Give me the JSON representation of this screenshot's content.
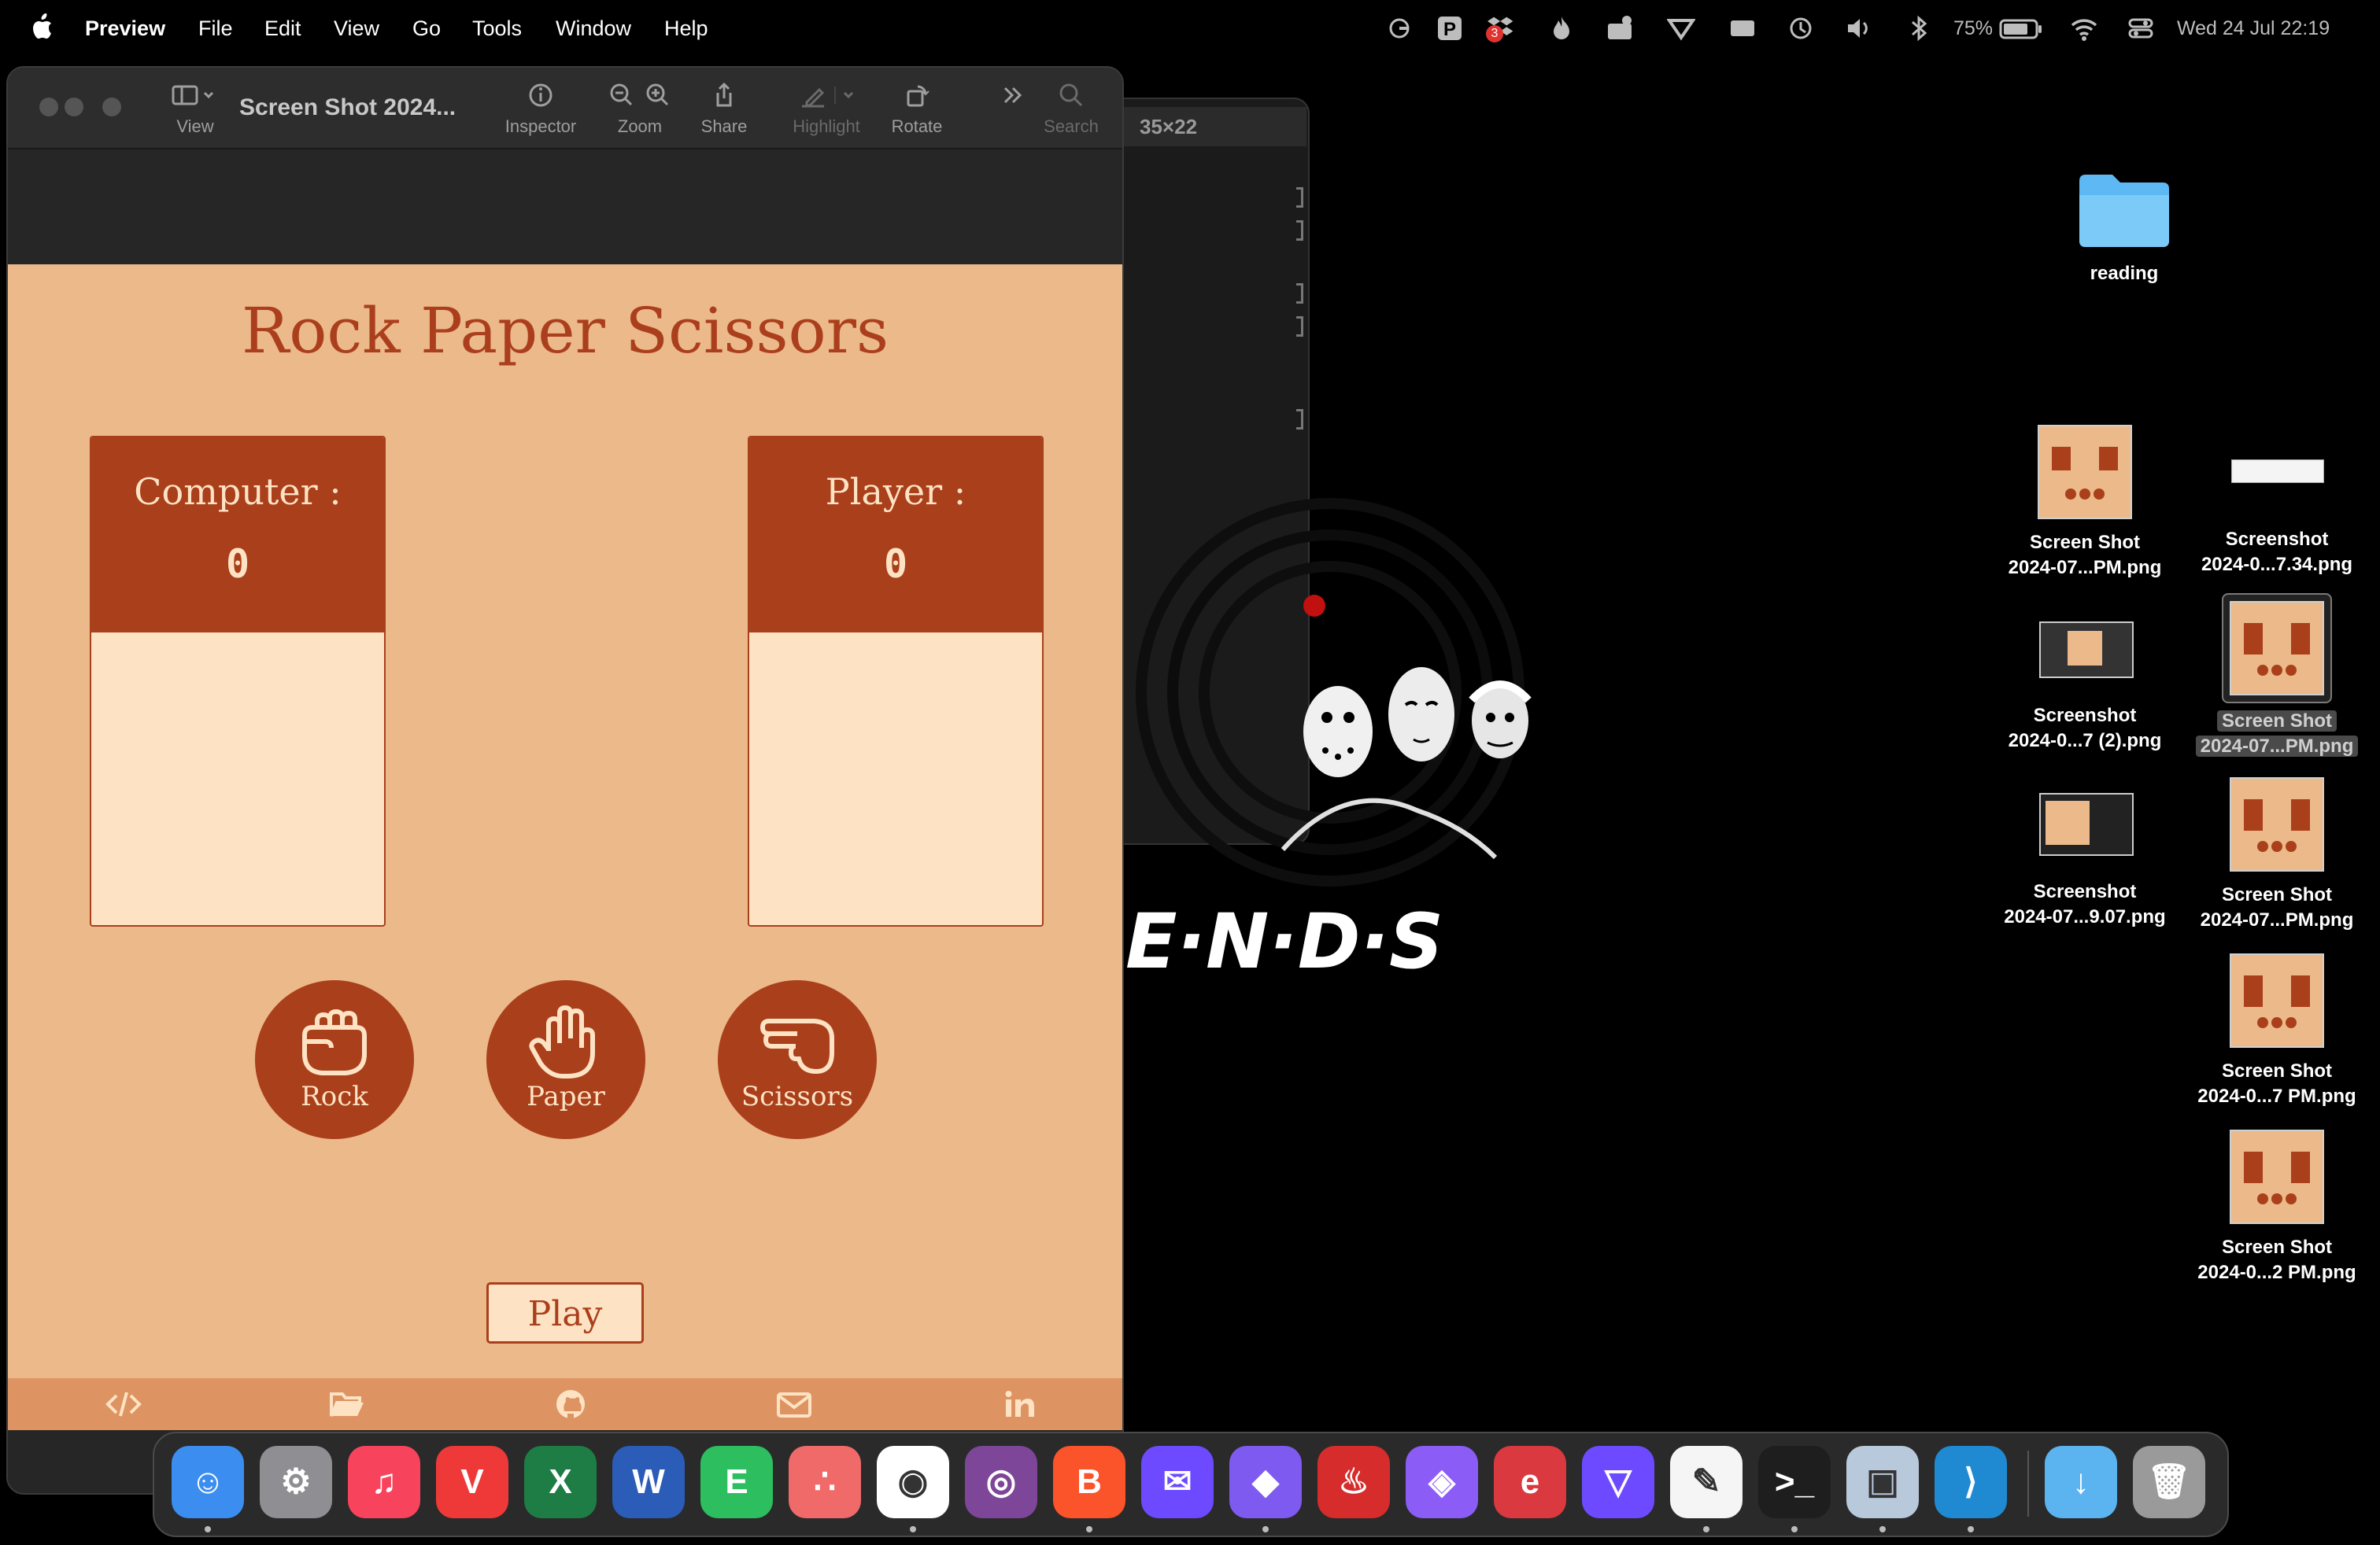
{
  "menubar": {
    "app_name": "Preview",
    "menus": [
      "File",
      "Edit",
      "View",
      "Go",
      "Tools",
      "Window",
      "Help"
    ],
    "battery": "75%",
    "datetime": "Wed 24 Jul  22:19",
    "notification_badge": "3"
  },
  "terminal": {
    "title": "35×22"
  },
  "wallpaper": {
    "text": "E·N·D·S"
  },
  "preview": {
    "doc_title": "Screen Shot 2024...",
    "toolbar": {
      "view": "View",
      "inspector": "Inspector",
      "zoom": "Zoom",
      "share": "Share",
      "highlight": "Highlight",
      "rotate": "Rotate",
      "search": "Search"
    }
  },
  "game": {
    "title": "Rock Paper Scissors",
    "computer_label": "Computer :",
    "computer_score": "0",
    "player_label": "Player :",
    "player_score": "0",
    "choices": [
      {
        "label": "Rock",
        "icon": "rock-hand-icon"
      },
      {
        "label": "Paper",
        "icon": "paper-hand-icon"
      },
      {
        "label": "Scissors",
        "icon": "scissors-hand-icon"
      }
    ],
    "play_label": "Play",
    "footer_icons": [
      "code-icon",
      "folder-icon",
      "github-icon",
      "mail-icon",
      "linkedin-icon"
    ],
    "colors": {
      "background": "#ebb98a",
      "primary": "#aa3f1b",
      "light": "#fde3c4",
      "footer": "#de9462"
    }
  },
  "desktop": {
    "folder": {
      "name": "reading"
    },
    "files": [
      {
        "line1": "Screen Shot",
        "line2": "2024-07...PM.png"
      },
      {
        "line1": "Screenshot",
        "line2": "2024-0...7.34.png"
      },
      {
        "line1": "Screenshot",
        "line2": "2024-0...7 (2).png"
      },
      {
        "line1": "Screen Shot",
        "line2": "2024-07...PM.png"
      },
      {
        "line1": "Screenshot",
        "line2": "2024-07...9.07.png"
      },
      {
        "line1": "Screen Shot",
        "line2": "2024-07...PM.png"
      },
      {
        "line1": "Screen Shot",
        "line2": "2024-0...7 PM.png"
      },
      {
        "line1": "Screen Shot",
        "line2": "2024-0...2 PM.png"
      }
    ]
  },
  "dock": {
    "apps": [
      {
        "name": "Finder",
        "icon": "finder-icon",
        "color": "#3b8ef0"
      },
      {
        "name": "System Settings",
        "icon": "settings-gear-icon",
        "color": "#8e8e93"
      },
      {
        "name": "Music",
        "icon": "music-icon",
        "color": "#f8435c"
      },
      {
        "name": "Vivaldi",
        "icon": "vivaldi-icon",
        "color": "#ef3939"
      },
      {
        "name": "Excel",
        "icon": "excel-icon",
        "color": "#1e7d45"
      },
      {
        "name": "Word",
        "icon": "word-icon",
        "color": "#2b5cb8"
      },
      {
        "name": "Evernote",
        "icon": "evernote-icon",
        "color": "#2dbe60"
      },
      {
        "name": "Asana",
        "icon": "asana-icon",
        "color": "#f06a6a"
      },
      {
        "name": "Chrome",
        "icon": "chrome-icon",
        "color": "#ffffff"
      },
      {
        "name": "Tor Browser",
        "icon": "tor-icon",
        "color": "#7d4698"
      },
      {
        "name": "Brave",
        "icon": "brave-icon",
        "color": "#fb542b"
      },
      {
        "name": "Proton Mail",
        "icon": "mail-app-icon",
        "color": "#6d4aff"
      },
      {
        "name": "Obsidian",
        "icon": "obsidian-icon",
        "color": "#7f5af0"
      },
      {
        "name": "Firefox-like",
        "icon": "flame-icon",
        "color": "#d72c2c"
      },
      {
        "name": "Shortcuts",
        "icon": "shortcuts-icon",
        "color": "#8b5cf6"
      },
      {
        "name": "ExpressVPN",
        "icon": "expressvpn-icon",
        "color": "#da3940"
      },
      {
        "name": "Proton VPN",
        "icon": "vpn-icon",
        "color": "#6d4aff"
      },
      {
        "name": "TextEdit",
        "icon": "textedit-icon",
        "color": "#f5f5f5"
      },
      {
        "name": "Terminal",
        "icon": "terminal-icon",
        "color": "#1e1e1e"
      },
      {
        "name": "Preview",
        "icon": "preview-icon",
        "color": "#b9c9dc"
      },
      {
        "name": "VS Code",
        "icon": "vscode-icon",
        "color": "#1f8ad2"
      },
      {
        "name": "Downloads",
        "icon": "downloads-folder-icon",
        "color": "#5bb4f0"
      },
      {
        "name": "Trash",
        "icon": "trash-icon",
        "color": "#9a9a9a"
      }
    ]
  }
}
